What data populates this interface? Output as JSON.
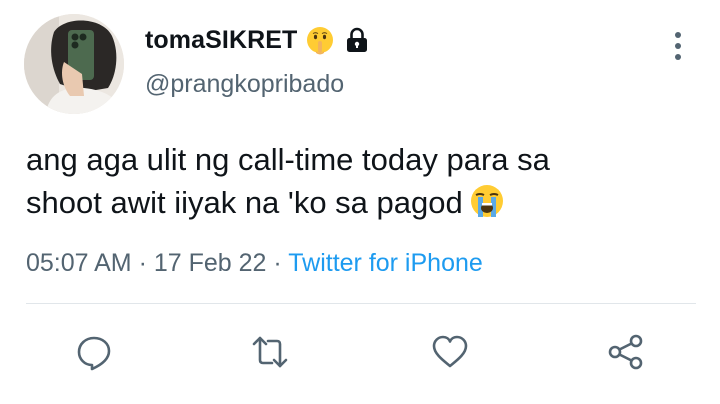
{
  "user": {
    "display_name": "tomaSIKRET",
    "handle": "@prangkopribado",
    "badge_icons": [
      "shushing-face-emoji",
      "lock-icon"
    ]
  },
  "tweet": {
    "text_line1": "ang aga ulit ng call-time today para sa",
    "text_line2": "shoot awit iiyak na 'ko sa pagod",
    "text_emoji": "loudly-crying-face-emoji",
    "time": "05:07 AM",
    "date": "17 Feb 22",
    "separator": "·",
    "source": "Twitter for iPhone"
  },
  "actions": {
    "icons": [
      "reply-icon",
      "retweet-icon",
      "like-icon",
      "share-icon"
    ]
  },
  "colors": {
    "text": "#0f1419",
    "secondary": "#536471",
    "accent": "#1d9bf0",
    "divider": "#e1e6ea"
  }
}
